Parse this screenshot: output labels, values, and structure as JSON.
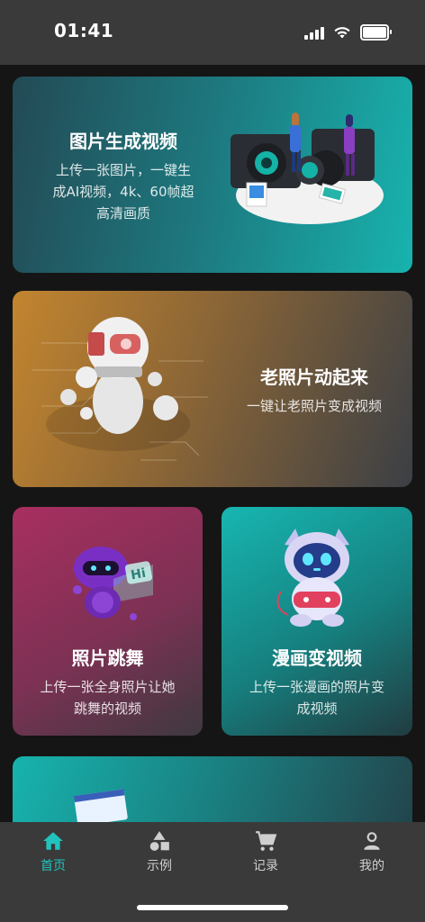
{
  "status_bar": {
    "time": "01:41"
  },
  "cards": [
    {
      "title": "图片生成视频",
      "desc_line1": "上传一张图片，一键生",
      "desc_line2": "成AI视频，4k、60帧超",
      "desc_line3": "高清画质"
    },
    {
      "title": "老照片动起来",
      "desc_line1": "一键让老照片变成视频"
    },
    {
      "title": "照片跳舞",
      "desc_line1": "上传一张全身照片让她",
      "desc_line2": "跳舞的视频"
    },
    {
      "title": "漫画变视频",
      "desc_line1": "上传一张漫画的照片变",
      "desc_line2": "成视频"
    }
  ],
  "badge_text": "Hi",
  "tabbar": {
    "items": [
      {
        "label": "首页",
        "icon": "home-icon",
        "active": true
      },
      {
        "label": "示例",
        "icon": "shapes-icon",
        "active": false
      },
      {
        "label": "记录",
        "icon": "cart-icon",
        "active": false
      },
      {
        "label": "我的",
        "icon": "person-icon",
        "active": false
      }
    ]
  },
  "colors": {
    "accent": "#22c3bd",
    "bar_bg": "#3a3a3a",
    "page_bg": "#151515"
  }
}
